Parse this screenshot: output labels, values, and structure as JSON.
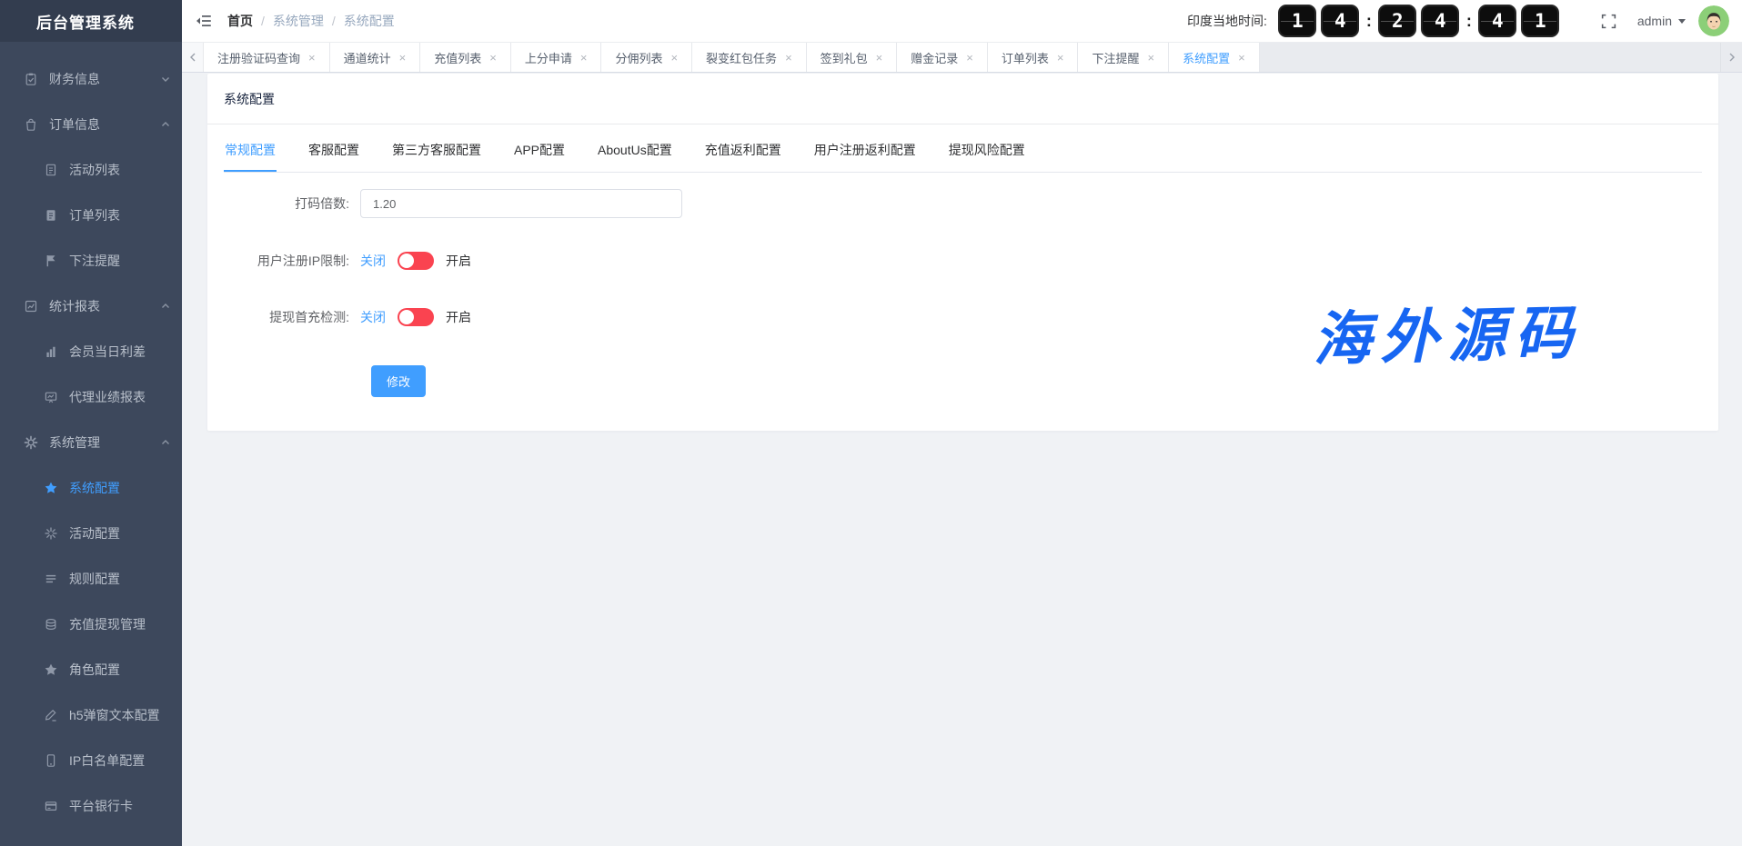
{
  "app": {
    "title": "后台管理系统"
  },
  "header": {
    "breadcrumb": [
      "首页",
      "系统管理",
      "系统配置"
    ],
    "breadcrumb_separator": "/",
    "clock": {
      "label": "印度当地时间:",
      "digits": [
        "1",
        "4",
        "2",
        "4",
        "4",
        "1"
      ],
      "separator": ":"
    },
    "user": {
      "name": "admin"
    }
  },
  "sidebar": {
    "items": [
      {
        "label": "财务信息",
        "icon": "clipboard-check-icon",
        "level": 1,
        "expand": "down"
      },
      {
        "label": "订单信息",
        "icon": "bag-icon",
        "level": 1,
        "expand": "up"
      },
      {
        "label": "活动列表",
        "icon": "document-icon",
        "level": 2
      },
      {
        "label": "订单列表",
        "icon": "document-filled-icon",
        "level": 2
      },
      {
        "label": "下注提醒",
        "icon": "flag-icon",
        "level": 2
      },
      {
        "label": "统计报表",
        "icon": "trend-chart-icon",
        "level": 1,
        "expand": "up"
      },
      {
        "label": "会员当日利差",
        "icon": "bar-chart-icon",
        "level": 2
      },
      {
        "label": "代理业绩报表",
        "icon": "presentation-icon",
        "level": 2
      },
      {
        "label": "系统管理",
        "icon": "gear-icon",
        "level": 1,
        "expand": "up"
      },
      {
        "label": "系统配置",
        "icon": "star-icon",
        "level": 2,
        "active": true
      },
      {
        "label": "活动配置",
        "icon": "burst-icon",
        "level": 2
      },
      {
        "label": "规则配置",
        "icon": "list-lines-icon",
        "level": 2
      },
      {
        "label": "充值提现管理",
        "icon": "database-icon",
        "level": 2
      },
      {
        "label": "角色配置",
        "icon": "star-icon",
        "level": 2
      },
      {
        "label": "h5弹窗文本配置",
        "icon": "pencil-icon",
        "level": 2
      },
      {
        "label": "IP白名单配置",
        "icon": "phone-icon",
        "level": 2
      },
      {
        "label": "平台银行卡",
        "icon": "bank-card-icon",
        "level": 2
      }
    ]
  },
  "tabbar": {
    "tabs": [
      {
        "label": "注册验证码查询"
      },
      {
        "label": "通道统计"
      },
      {
        "label": "充值列表"
      },
      {
        "label": "上分申请"
      },
      {
        "label": "分佣列表"
      },
      {
        "label": "裂变红包任务"
      },
      {
        "label": "签到礼包"
      },
      {
        "label": "赠金记录"
      },
      {
        "label": "订单列表"
      },
      {
        "label": "下注提醒"
      },
      {
        "label": "系统配置",
        "active": true
      }
    ]
  },
  "main": {
    "card_title": "系统配置",
    "tabs": [
      {
        "label": "常规配置",
        "active": true
      },
      {
        "label": "客服配置"
      },
      {
        "label": "第三方客服配置"
      },
      {
        "label": "APP配置"
      },
      {
        "label": "AboutUs配置"
      },
      {
        "label": "充值返利配置"
      },
      {
        "label": "用户注册返利配置"
      },
      {
        "label": "提现风险配置"
      }
    ],
    "form": {
      "multiplier": {
        "label": "打码倍数:",
        "value": "1.20"
      },
      "ip_limit": {
        "label": "用户注册IP限制:",
        "off": "关闭",
        "on": "开启"
      },
      "withdraw_check": {
        "label": "提现首充检测:",
        "off": "关闭",
        "on": "开启"
      },
      "submit": "修改"
    },
    "watermark": "海外源码"
  },
  "icons": {
    "close": "×"
  },
  "colors": {
    "accent": "#409eff",
    "toggle_off_red": "#fa4350",
    "watermark_blue": "#1766f2",
    "sidebar_bg": "#3d485c",
    "sidebar_logo_bg": "#333d4f"
  }
}
